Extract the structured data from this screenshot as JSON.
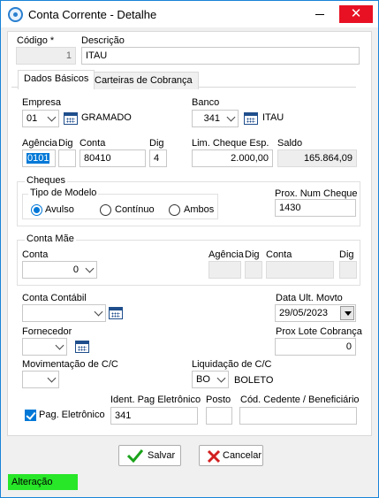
{
  "window": {
    "title": "Conta Corrente  - Detalhe"
  },
  "form": {
    "codigo": {
      "label": "Código *",
      "value": "1"
    },
    "descricao": {
      "label": "Descrição",
      "value": "ITAU"
    }
  },
  "tabs": [
    {
      "label": "Dados Básicos",
      "active": true
    },
    {
      "label": "Carteiras de Cobrança",
      "active": false
    }
  ],
  "basic": {
    "empresa": {
      "label": "Empresa",
      "code": "01",
      "name": "GRAMADO"
    },
    "banco": {
      "label": "Banco",
      "code": "341",
      "name": "ITAU"
    },
    "agencia": {
      "label": "Agência",
      "value": "0101"
    },
    "agencia_dig": {
      "label": "Dig",
      "value": ""
    },
    "conta": {
      "label": "Conta",
      "value": "80410"
    },
    "conta_dig": {
      "label": "Dig",
      "value": "4"
    },
    "lim_cheque": {
      "label": "Lim. Cheque Esp.",
      "value": "2.000,00"
    },
    "saldo": {
      "label": "Saldo",
      "value": "165.864,09"
    }
  },
  "cheques": {
    "title": "Cheques",
    "tipo_modelo": {
      "label": "Tipo de Modelo",
      "options": [
        "Avulso",
        "Contínuo",
        "Ambos"
      ],
      "selected": "Avulso"
    },
    "prox_num": {
      "label": "Prox. Num Cheque",
      "value": "1430"
    }
  },
  "conta_mae": {
    "title": "Conta Mãe",
    "conta": {
      "label": "Conta",
      "value": "0"
    },
    "agencia": {
      "label": "Agência",
      "value": ""
    },
    "agencia_dig": {
      "label": "Dig",
      "value": ""
    },
    "conta_num": {
      "label": "Conta",
      "value": ""
    },
    "conta_dig": {
      "label": "Dig",
      "value": ""
    }
  },
  "extra": {
    "conta_contabil": {
      "label": "Conta Contábil",
      "value": ""
    },
    "data_ult_movto": {
      "label": "Data Ult. Movto",
      "value": "29/05/2023"
    },
    "fornecedor": {
      "label": "Fornecedor",
      "value": ""
    },
    "prox_lote": {
      "label": "Prox Lote Cobrança",
      "value": "0"
    },
    "movimentacao": {
      "label": "Movimentação de C/C",
      "value": ""
    },
    "liquidacao": {
      "label": "Liquidação de C/C",
      "code": "BO",
      "name": "BOLETO"
    },
    "pag_eletronico": {
      "label": "Pag. Eletrônico",
      "checked": true
    },
    "ident_pag": {
      "label": "Ident. Pag Eletrônico",
      "value": "341"
    },
    "posto": {
      "label": "Posto",
      "value": ""
    },
    "cod_cedente": {
      "label": "Cód. Cedente / Beneficiário",
      "value": ""
    }
  },
  "buttons": {
    "save": "Salvar",
    "cancel": "Cancelar"
  },
  "status": {
    "text": "Alteração",
    "color": "#28e628"
  },
  "colors": {
    "accent": "#0078d7",
    "close": "#e81123",
    "save_icon": "#1aa31a",
    "cancel_icon": "#d21f1f"
  }
}
